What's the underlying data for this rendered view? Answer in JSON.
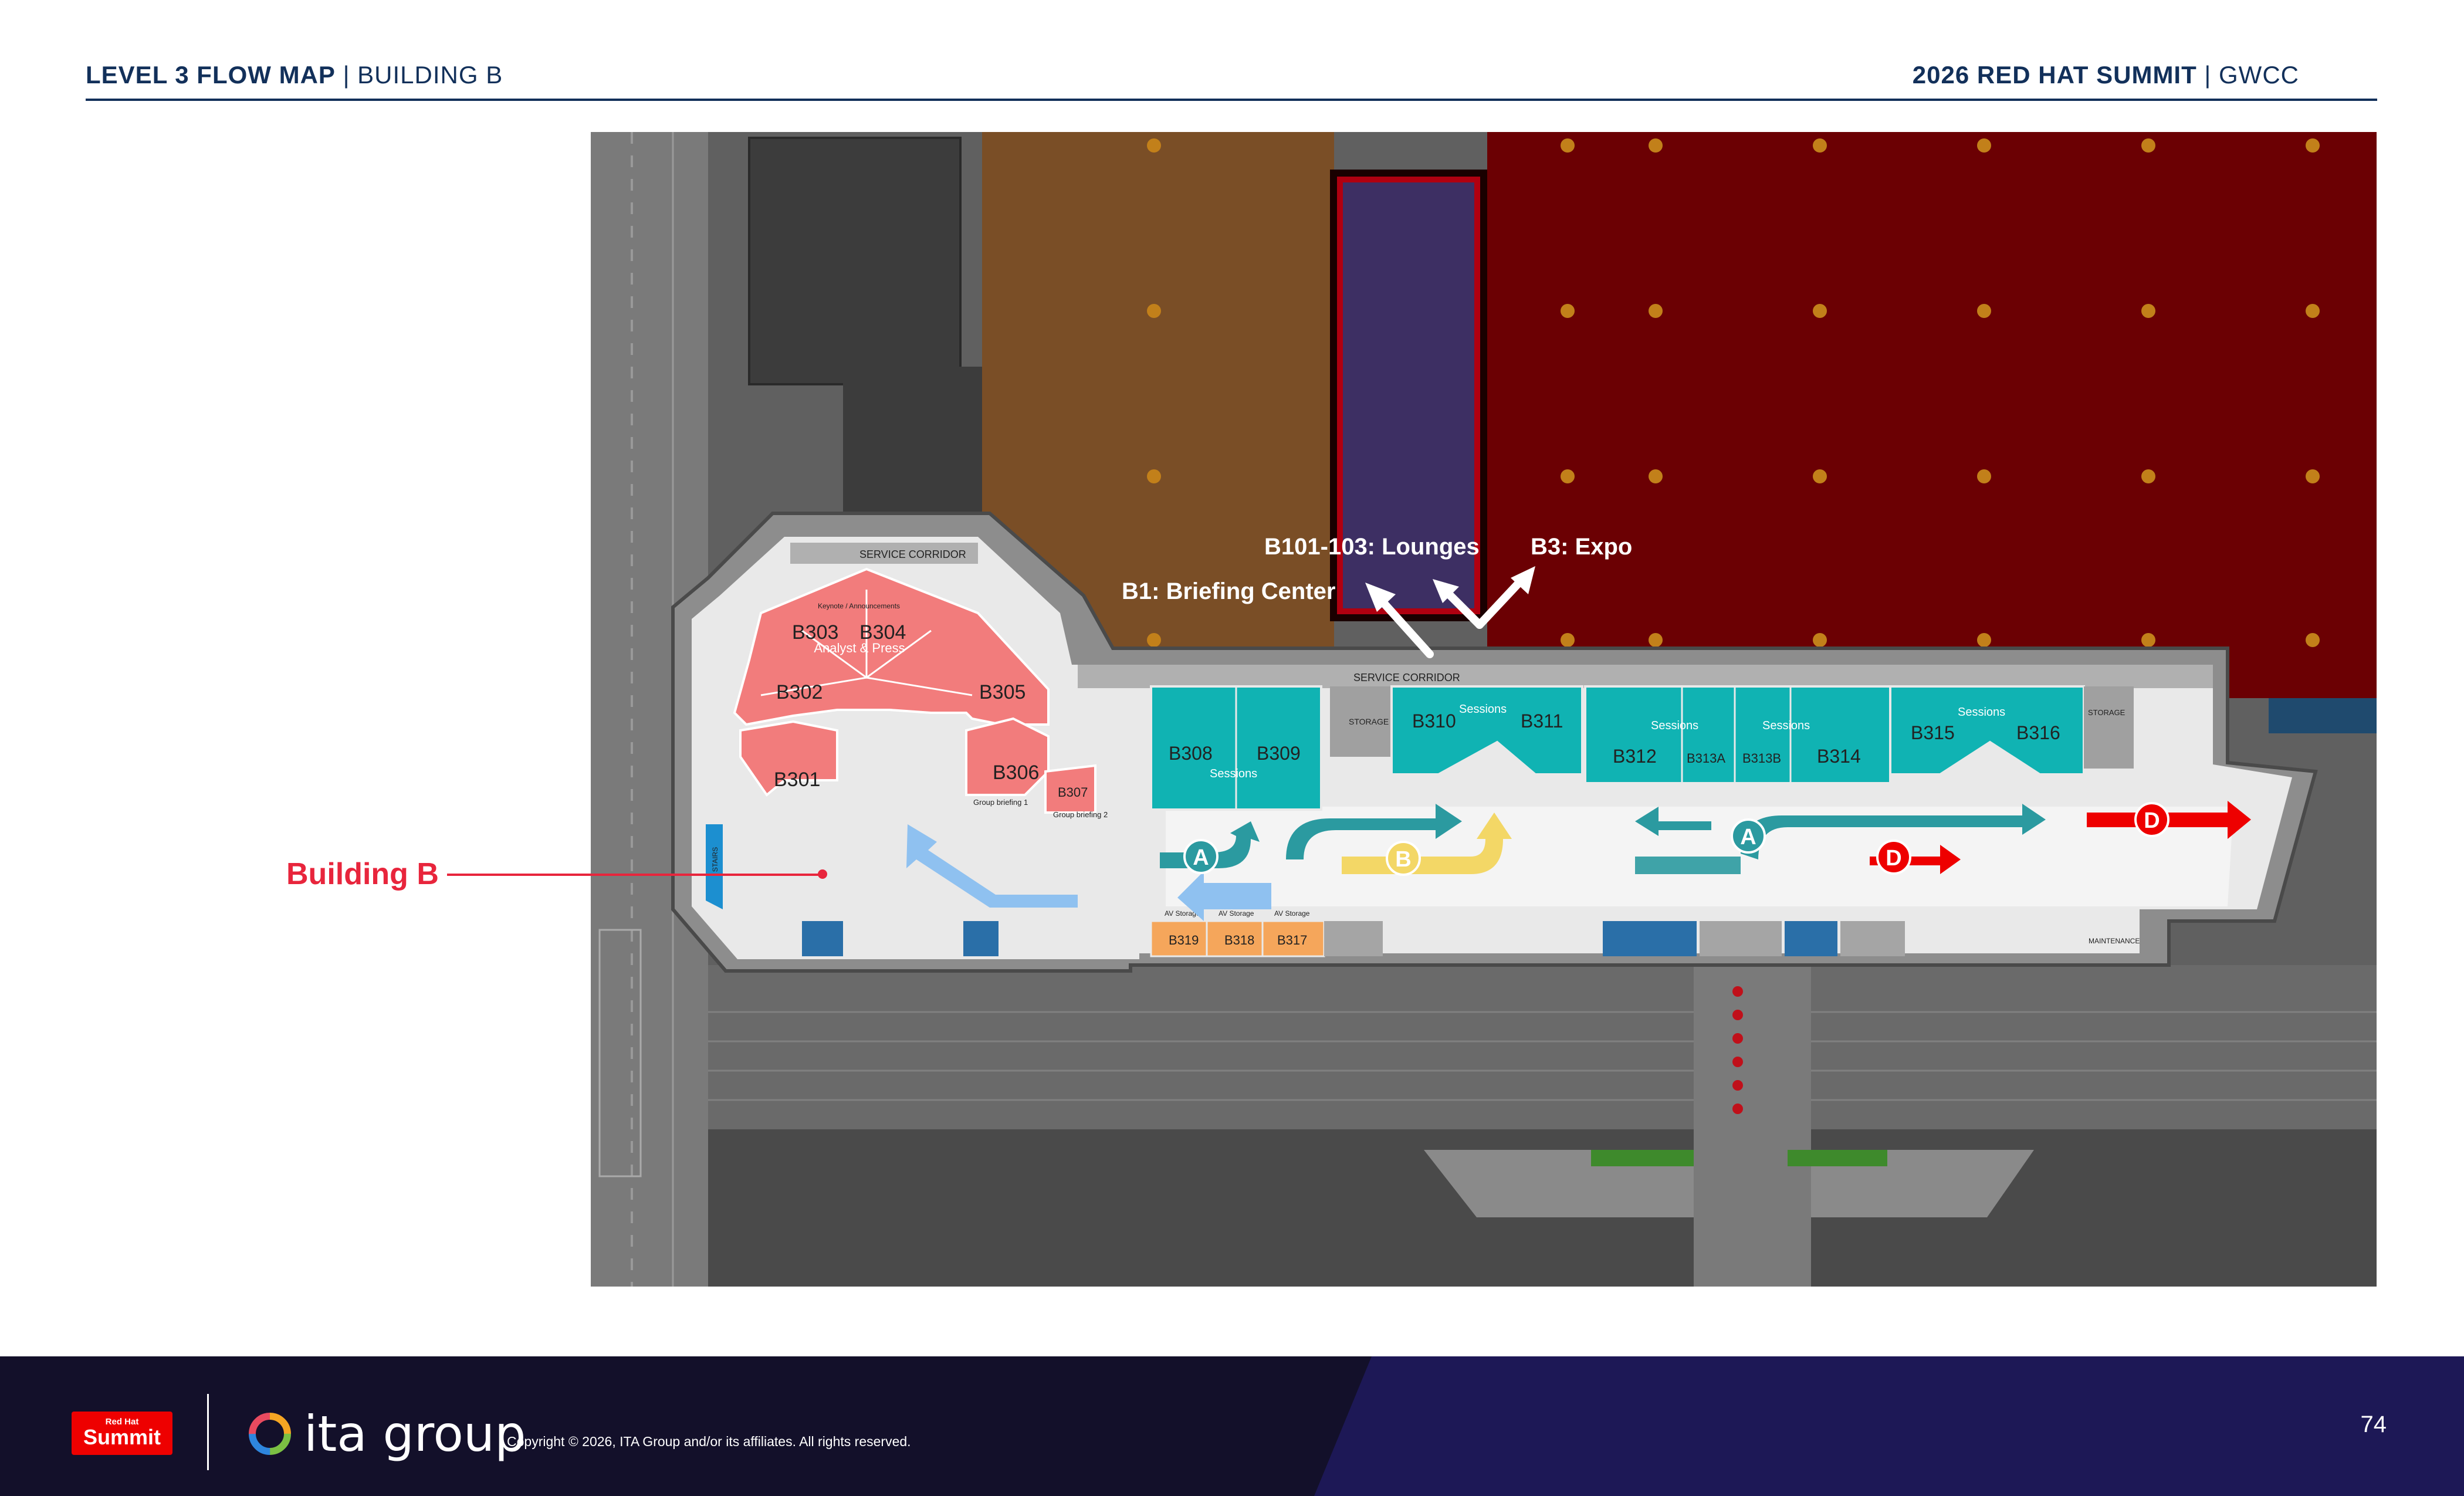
{
  "header": {
    "left_bold": "LEVEL 3 FLOW MAP",
    "left_rest": " | BUILDING B",
    "right_bold": "2026 RED HAT SUMMIT",
    "right_rest": " | GWCC"
  },
  "map": {
    "destinations": {
      "lounges": "B101-103: Lounges",
      "expo": "B3: Expo",
      "briefing": "B1: Briefing Center"
    },
    "corridor_top": "SERVICE CORRIDOR",
    "corridor_main": "SERVICE CORRIDOR",
    "rooms_red": [
      "B303",
      "B304",
      "B302",
      "B305",
      "B301",
      "B306",
      "B307"
    ],
    "analyst_label": "Analyst & Press",
    "keynote_label": "Keynote / Announcements",
    "group_briefing_1": "Group briefing 1",
    "group_briefing_2": "Group briefing 2",
    "rooms_teal": [
      "B308",
      "B309",
      "B310",
      "B311",
      "B312",
      "B313A",
      "B313B",
      "B314",
      "B315",
      "B316"
    ],
    "sessions_label": "Sessions",
    "storage_label": "STORAGE",
    "maintenance_label": "MAINTENANCE",
    "rooms_orange": [
      "B319",
      "B318",
      "B317"
    ],
    "av_storage_label": "AV Storage",
    "stairs_label": "STAIRS",
    "flow_markers": {
      "a": "A",
      "b": "B",
      "d": "D"
    },
    "colors": {
      "expo_hall": "#6b0003",
      "lounge_hall": "#7a4e26",
      "briefing_hall": "#3d2f63",
      "analyst_rooms": "#f27c7c",
      "session_rooms": "#10b3b3",
      "av_storage": "#f5a65b",
      "flow_a": "#2b9aa0",
      "flow_b": "#f3d766",
      "flow_d": "#ee0000",
      "flow_light": "#8fc1f0"
    }
  },
  "callout": {
    "label": "Building B"
  },
  "footer": {
    "badge_top": "Red Hat",
    "badge_bottom": "Summit",
    "brand": "ita group",
    "copyright": "Copyright © 2026, ITA Group and/or its affiliates. All rights reserved.",
    "page_number": "74"
  }
}
